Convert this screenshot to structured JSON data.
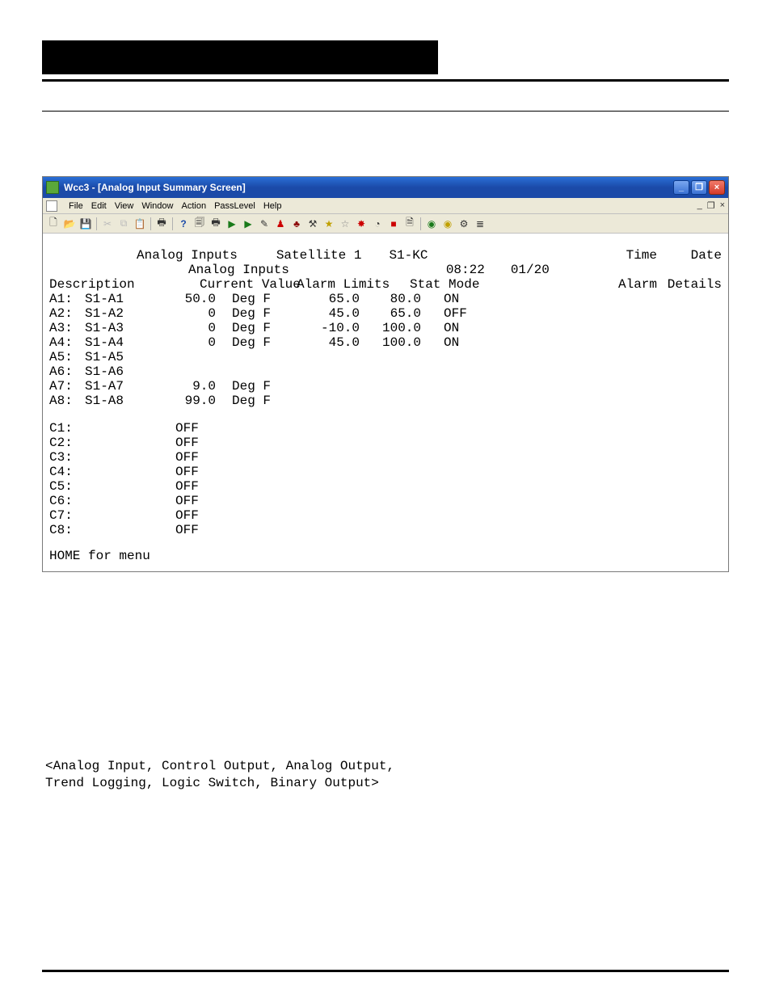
{
  "window": {
    "title": "Wcc3 - [Analog Input Summary Screen]",
    "menus": [
      "File",
      "Edit",
      "View",
      "Window",
      "Action",
      "PassLevel",
      "Help"
    ],
    "mdi": {
      "restore": "_",
      "max": "❐",
      "close": "×"
    },
    "win_ctrls": {
      "min": "_",
      "max": "❐",
      "close": "×"
    },
    "toolbar_icons": [
      "new",
      "open",
      "save",
      "|",
      "cut",
      "copy",
      "paste",
      "|",
      "print",
      "|",
      "help",
      "binoc1",
      "binoc2",
      "run1",
      "run2",
      "user",
      "clock",
      "bug",
      "star",
      "star2",
      "star3",
      "clock2",
      "stop",
      "paper",
      "|",
      "sat",
      "globe",
      "tree",
      "list"
    ]
  },
  "screen": {
    "header": {
      "left": "Analog Inputs",
      "center1": "Satellite  1",
      "center2": "S1-KC",
      "subtitle": "Analog Inputs",
      "time_label": "Time",
      "date_label": "Date",
      "time": "08:22",
      "date": "01/20"
    },
    "cols": {
      "description": "Description",
      "current_value": "Current Value",
      "alarm_limits": "Alarm Limits",
      "stat_mode": "Stat Mode",
      "alarm": "Alarm",
      "details": "Details"
    },
    "analog_rows": [
      {
        "id": "A1:",
        "desc": "S1-A1",
        "val": "50.0",
        "unit": "Deg F",
        "lo": "65.0",
        "hi": "80.0",
        "stat": "ON"
      },
      {
        "id": "A2:",
        "desc": "S1-A2",
        "val": "0",
        "unit": "Deg F",
        "lo": "45.0",
        "hi": "65.0",
        "stat": "OFF"
      },
      {
        "id": "A3:",
        "desc": "S1-A3",
        "val": "0",
        "unit": "Deg F",
        "lo": "-10.0",
        "hi": "100.0",
        "stat": "ON"
      },
      {
        "id": "A4:",
        "desc": "S1-A4",
        "val": "0",
        "unit": "Deg F",
        "lo": "45.0",
        "hi": "100.0",
        "stat": "ON"
      },
      {
        "id": "A5:",
        "desc": "S1-A5",
        "val": "",
        "unit": "",
        "lo": "",
        "hi": "",
        "stat": ""
      },
      {
        "id": "A6:",
        "desc": "S1-A6",
        "val": "",
        "unit": "",
        "lo": "",
        "hi": "",
        "stat": ""
      },
      {
        "id": "A7:",
        "desc": "S1-A7",
        "val": "9.0",
        "unit": "Deg F",
        "lo": "",
        "hi": "",
        "stat": ""
      },
      {
        "id": "A8:",
        "desc": "S1-A8",
        "val": "99.0",
        "unit": "Deg F",
        "lo": "",
        "hi": "",
        "stat": ""
      }
    ],
    "c_rows": [
      {
        "id": "C1:",
        "val": "OFF"
      },
      {
        "id": "C2:",
        "val": "OFF"
      },
      {
        "id": "C3:",
        "val": "OFF"
      },
      {
        "id": "C4:",
        "val": "OFF"
      },
      {
        "id": "C5:",
        "val": "OFF"
      },
      {
        "id": "C6:",
        "val": "OFF"
      },
      {
        "id": "C7:",
        "val": "OFF"
      },
      {
        "id": "C8:",
        "val": "OFF"
      }
    ],
    "footer": "HOME for menu"
  },
  "code_note": {
    "l1": "<Analog Input, Control Output, Analog Output,",
    "l2": " Trend Logging, Logic Switch, Binary Output>"
  }
}
